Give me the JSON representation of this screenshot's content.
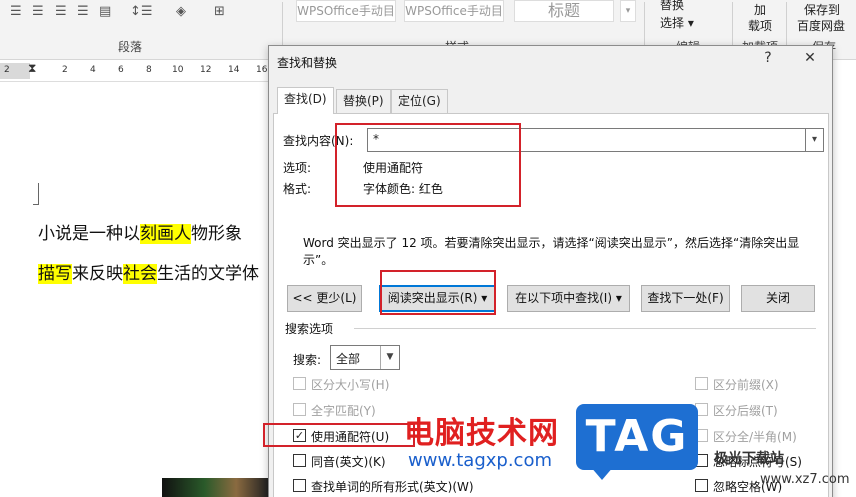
{
  "ribbon": {
    "paragraph_group_label": "段落",
    "style_group_label": "样式",
    "edit_group_label": "编辑",
    "addin_group_label": "加载项",
    "save_group_label": "保存",
    "style_items": [
      "WPSOffice手动目",
      "WPSOffice手动目",
      "标题"
    ],
    "replace_label": "替换",
    "select_label": "选择",
    "addin_label_line1": "加",
    "addin_label_line2": "载项",
    "save_label_line1": "保存到",
    "save_label_line2": "百度网盘"
  },
  "ruler": {
    "numbers": [
      "2",
      "2",
      "4",
      "6",
      "8",
      "10",
      "12",
      "14",
      "16"
    ]
  },
  "document": {
    "line1_a": "小说是一种以",
    "line1_hl": "刻画人",
    "line1_b": "物形象",
    "line2_hl1": "描写",
    "line2_a": "来反映",
    "line2_hl2": "社会",
    "line2_b": "生活的文学体"
  },
  "dialog": {
    "title": "查找和替换",
    "help": "?",
    "close": "✕",
    "tabs": [
      "查找(D)",
      "替换(P)",
      "定位(G)"
    ],
    "find_label": "查找内容(N):",
    "find_value": "*",
    "options_label": "选项:",
    "options_value": "使用通配符",
    "format_label": "格式:",
    "format_value": "字体颜色: 红色",
    "message": "Word 突出显示了 12 项。若要清除突出显示，请选择“阅读突出显示”，然后选择“清除突出显示”。",
    "buttons": {
      "less": "<< 更少(L)",
      "reading_highlight": "阅读突出显示(R) ▾",
      "find_in": "在以下项中查找(I) ▾",
      "find_next": "查找下一处(F)",
      "close": "关闭"
    },
    "search_options_header": "搜索选项",
    "search_label": "搜索:",
    "search_value": "全部",
    "left_options": [
      {
        "label": "区分大小写(H)",
        "checked": false,
        "disabled": true
      },
      {
        "label": "全字匹配(Y)",
        "checked": false,
        "disabled": true
      },
      {
        "label": "使用通配符(U)",
        "checked": true,
        "disabled": false
      },
      {
        "label": "同音(英文)(K)",
        "checked": false,
        "disabled": false
      },
      {
        "label": "查找单词的所有形式(英文)(W)",
        "checked": false,
        "disabled": false
      }
    ],
    "right_options": [
      {
        "label": "区分前缀(X)",
        "checked": false,
        "disabled": true
      },
      {
        "label": "区分后缀(T)",
        "checked": false,
        "disabled": true
      },
      {
        "label": "区分全/半角(M)",
        "checked": false,
        "disabled": true
      },
      {
        "label": "忽略标点符号(S)",
        "checked": false,
        "disabled": false
      },
      {
        "label": "忽略空格(W)",
        "checked": false,
        "disabled": false
      }
    ]
  },
  "watermark": {
    "site_name": "电脑技术网",
    "site_url": "www.tagxp.com",
    "logo_text": "TAG",
    "right_text": "极光下载站",
    "right_url": "www.xz7.com"
  },
  "colors": {
    "highlight": "#ffff00",
    "annotation_red": "#d3222a",
    "focus_blue": "#0078d7"
  }
}
